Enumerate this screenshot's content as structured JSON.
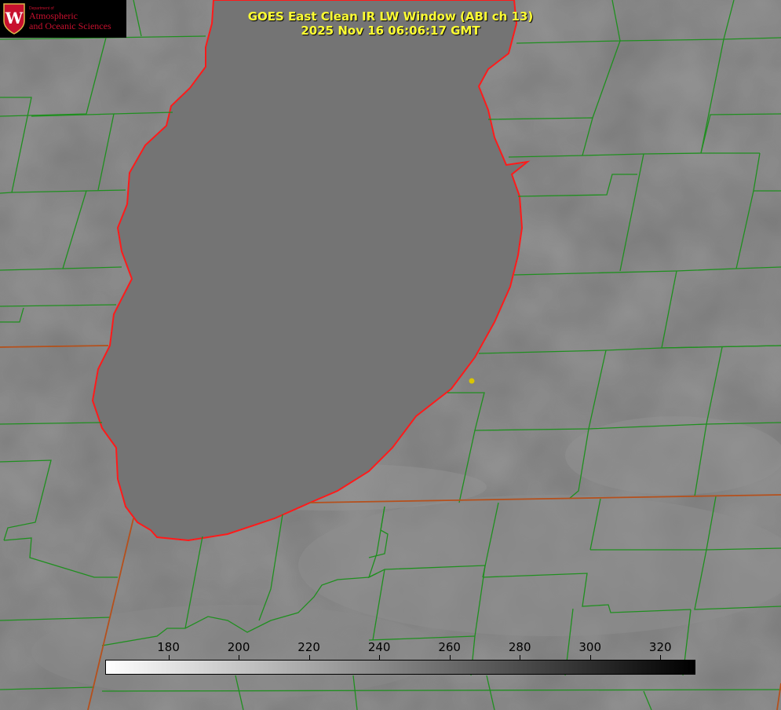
{
  "header": {
    "title_line1": "GOES East Clean IR LW Window (ABI ch 13)",
    "title_line2": "2025 Nov 16 06:06:17 GMT"
  },
  "logo": {
    "dept_text": "Department of",
    "line1": "Atmospheric",
    "line2": "and Oceanic Sciences",
    "seal_letter": "W",
    "seal_icon": "uw-crest-icon"
  },
  "colorbar": {
    "ticks": [
      "180",
      "200",
      "220",
      "240",
      "260",
      "280",
      "300",
      "320"
    ],
    "tick_values": [
      180,
      200,
      220,
      240,
      260,
      280,
      300,
      320
    ],
    "min": 162,
    "max": 330,
    "gradient": [
      "#ffffff",
      "#808080",
      "#000000"
    ]
  },
  "colors": {
    "background_gray": "#7d7d7d",
    "lake_gray": "#767676",
    "lake_outline": "#ff1a1a",
    "county_lines": "#1f8f1f",
    "title_yellow": "#ffff33",
    "marker_yellow": "#d9c500"
  }
}
